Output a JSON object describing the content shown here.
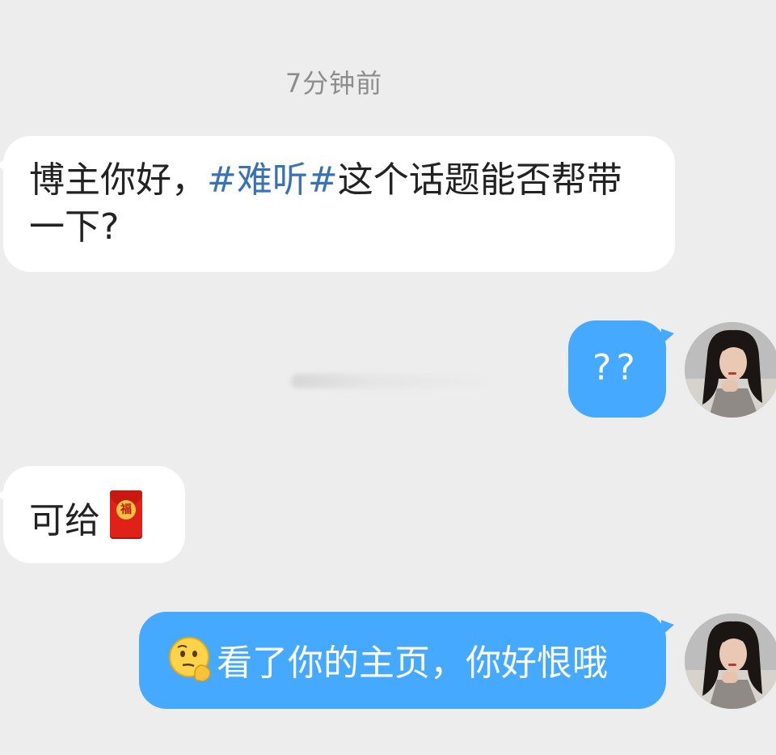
{
  "timestamp": "7分钟前",
  "messages": [
    {
      "side": "left",
      "prefix": "博主你好，",
      "topic": "#难听#",
      "suffix": "这个话题能否帮带一下?"
    },
    {
      "side": "right",
      "text": "??"
    },
    {
      "side": "left",
      "text": "可给",
      "emoji": "red-envelope"
    },
    {
      "side": "right",
      "text": "看了你的主页，你好恨哦",
      "emoji": "thinking-face"
    }
  ],
  "red_envelope_char": "福",
  "colors": {
    "background": "#ededed",
    "bubble_left": "#ffffff",
    "bubble_right": "#45a9ff",
    "topic": "#3a73b3",
    "timestamp": "#8d8d8d"
  }
}
